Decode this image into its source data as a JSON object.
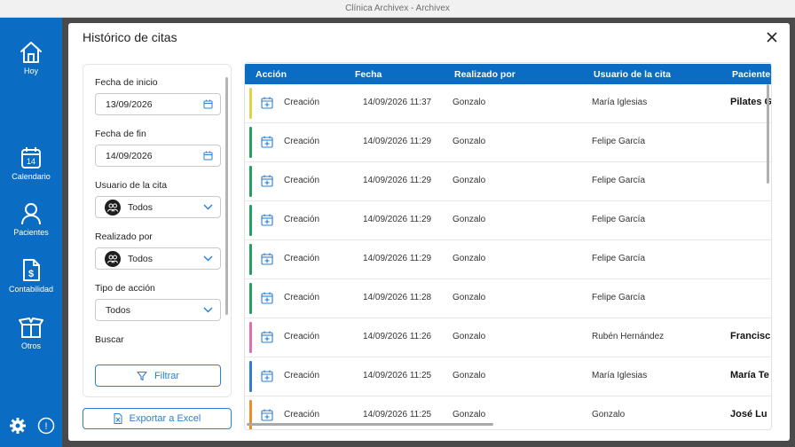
{
  "window": {
    "title": "Clínica Archivex - Archivex"
  },
  "sidebar": {
    "items": [
      {
        "label": "Hoy",
        "icon": "home-icon"
      },
      {
        "label": "Calendario",
        "icon": "calendar-icon",
        "day": "14"
      },
      {
        "label": "Pacientes",
        "icon": "person-icon"
      },
      {
        "label": "Contabilidad",
        "icon": "invoice-icon"
      },
      {
        "label": "Otros",
        "icon": "box-icon"
      }
    ],
    "bottom": {
      "settings_icon": "gear-icon",
      "info_icon": "info-icon",
      "info_glyph": "!"
    }
  },
  "modal": {
    "title": "Histórico de citas",
    "filters": {
      "start_label": "Fecha de inicio",
      "start_value": "13/09/2026",
      "end_label": "Fecha de fin",
      "end_value": "14/09/2026",
      "user_label": "Usuario de la cita",
      "user_value": "Todos",
      "performer_label": "Realizado por",
      "performer_value": "Todos",
      "action_label": "Tipo de acción",
      "action_value": "Todos",
      "search_label": "Buscar",
      "filter_button": "Filtrar"
    },
    "export_button": "Exportar a Excel",
    "table": {
      "columns": [
        "Acción",
        "Fecha",
        "Realizado por",
        "Usuario de la cita",
        "Paciente"
      ],
      "rows": [
        {
          "accion": "Creación",
          "fecha": "14/09/2026 11:37",
          "realizado_por": "Gonzalo",
          "usuario": "María Iglesias",
          "paciente": "Pilates G",
          "color": "#e6d04a"
        },
        {
          "accion": "Creación",
          "fecha": "14/09/2026 11:29",
          "realizado_por": "Gonzalo",
          "usuario": "Felipe García",
          "paciente": "",
          "color": "#1fa35c"
        },
        {
          "accion": "Creación",
          "fecha": "14/09/2026 11:29",
          "realizado_por": "Gonzalo",
          "usuario": "Felipe García",
          "paciente": "",
          "color": "#1fa35c"
        },
        {
          "accion": "Creación",
          "fecha": "14/09/2026 11:29",
          "realizado_por": "Gonzalo",
          "usuario": "Felipe García",
          "paciente": "",
          "color": "#1fa35c"
        },
        {
          "accion": "Creación",
          "fecha": "14/09/2026 11:29",
          "realizado_por": "Gonzalo",
          "usuario": "Felipe García",
          "paciente": "",
          "color": "#1fa35c"
        },
        {
          "accion": "Creación",
          "fecha": "14/09/2026 11:28",
          "realizado_por": "Gonzalo",
          "usuario": "Felipe García",
          "paciente": "",
          "color": "#1fa35c"
        },
        {
          "accion": "Creación",
          "fecha": "14/09/2026 11:26",
          "realizado_por": "Gonzalo",
          "usuario": "Rubén Hernández",
          "paciente": "Francisc",
          "color": "#e86aa8"
        },
        {
          "accion": "Creación",
          "fecha": "14/09/2026 11:25",
          "realizado_por": "Gonzalo",
          "usuario": "María Iglesias",
          "paciente": "María Te",
          "color": "#2a7fd0"
        },
        {
          "accion": "Creación",
          "fecha": "14/09/2026 11:25",
          "realizado_por": "Gonzalo",
          "usuario": "Gonzalo",
          "paciente": "José Lu",
          "color": "#f08a2a"
        }
      ]
    }
  },
  "colors": {
    "brand": "#0a6cc2",
    "accent": "#2a7fd0"
  }
}
